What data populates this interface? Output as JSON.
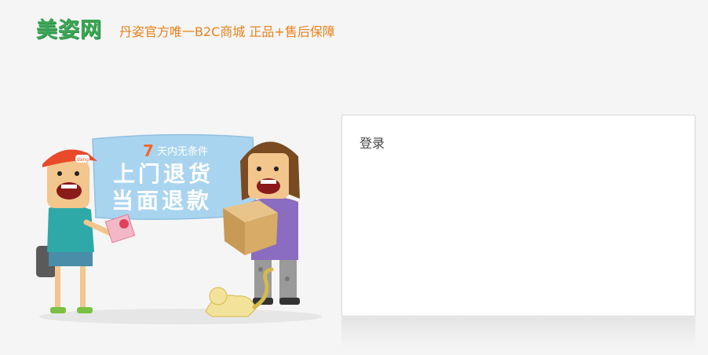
{
  "header": {
    "logo_text": "美姿网",
    "slogan": "丹姿官方唯一B2C商城 正品+售后保障"
  },
  "banner": {
    "days": "7",
    "line1": "天内无条件",
    "line2": "上门退货",
    "line3": "当面退款",
    "cap_text": "dang"
  },
  "login": {
    "title": "登录"
  },
  "colors": {
    "logo_green": "#3aa655",
    "slogan_orange": "#e8821c",
    "banner_blue": "#a9d4ef"
  }
}
